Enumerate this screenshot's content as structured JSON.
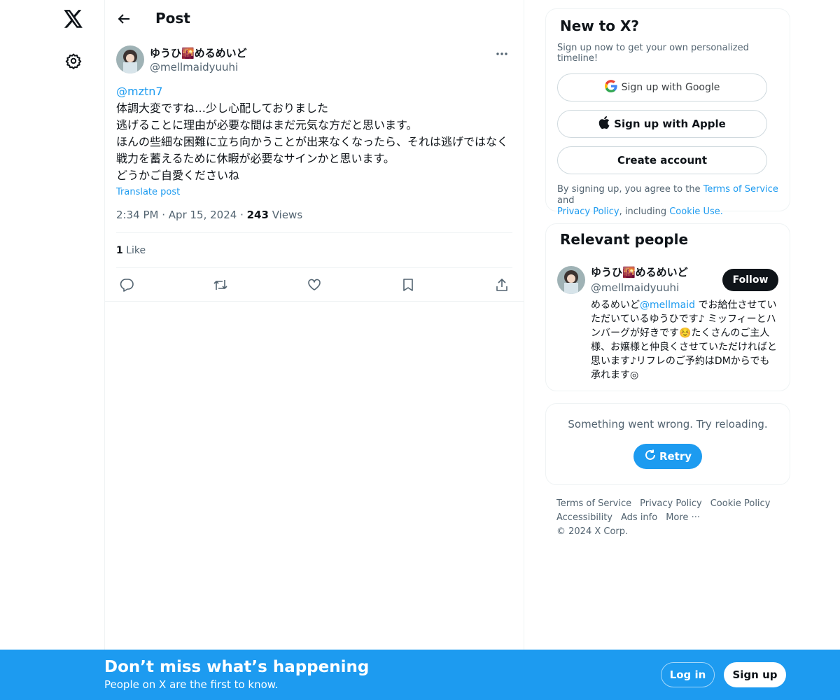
{
  "colors": {
    "accent": "#1d9bf0",
    "text": "#0f1419",
    "secondary": "#536471",
    "border": "#eff3f4"
  },
  "nav": {
    "logo_icon": "x-logo-icon",
    "settings_icon": "gear-icon"
  },
  "header": {
    "title": "Post",
    "back_icon": "arrow-left-icon"
  },
  "post": {
    "author_name": "ゆうひ🌇めるめいど",
    "author_handle": "@mellmaidyuuhi",
    "mention": "@mztn7",
    "body": "体調大変ですね…少し心配しておりました\n逃げることに理由が必要な間はまだ元気な方だと思います。\nほんの些細な困難に立ち向かうことが出来なくなったら、それは逃げではなく戦力を蓄えるために休暇が必要なサインかと思います。\nどうかご自愛くださいね",
    "translate_label": "Translate post",
    "time": "2:34 PM",
    "date": "Apr 15, 2024",
    "views_count": "243",
    "views_label": "Views",
    "likes_count": "1",
    "likes_label": "Like"
  },
  "signup_card": {
    "title": "New to X?",
    "subtitle": "Sign up now to get your own personalized timeline!",
    "google_label": "Sign up with Google",
    "apple_label": "Sign up with Apple",
    "create_label": "Create account",
    "legal_prefix": "By signing up, you agree to the ",
    "terms_link": "Terms of Service",
    "legal_and": " and",
    "privacy_link": "Privacy Policy",
    "legal_including": ", including ",
    "cookie_link": "Cookie Use."
  },
  "relevant_people": {
    "title": "Relevant people",
    "name": "ゆうひ🌇めるめいど",
    "handle": "@mellmaidyuuhi",
    "follow_label": "Follow",
    "bio_prefix": "めるめいど",
    "bio_mention": "@mellmaid",
    "bio_rest": " でお給仕させていただいているゆうひです♪ ミッフィーとハンバーグが好きです☺️たくさんのご主人様、お嬢様と仲良くさせていただければと思います♪リフレのご予約はDMからでも承れます◎"
  },
  "error_card": {
    "message": "Something went wrong. Try reloading.",
    "retry_label": "Retry"
  },
  "footer": {
    "links": [
      "Terms of Service",
      "Privacy Policy",
      "Cookie Policy",
      "Accessibility",
      "Ads info",
      "More ···",
      "© 2024 X Corp."
    ]
  },
  "bottom_bar": {
    "title": "Don’t miss what’s happening",
    "subtitle": "People on X are the first to know.",
    "login_label": "Log in",
    "signup_label": "Sign up"
  }
}
